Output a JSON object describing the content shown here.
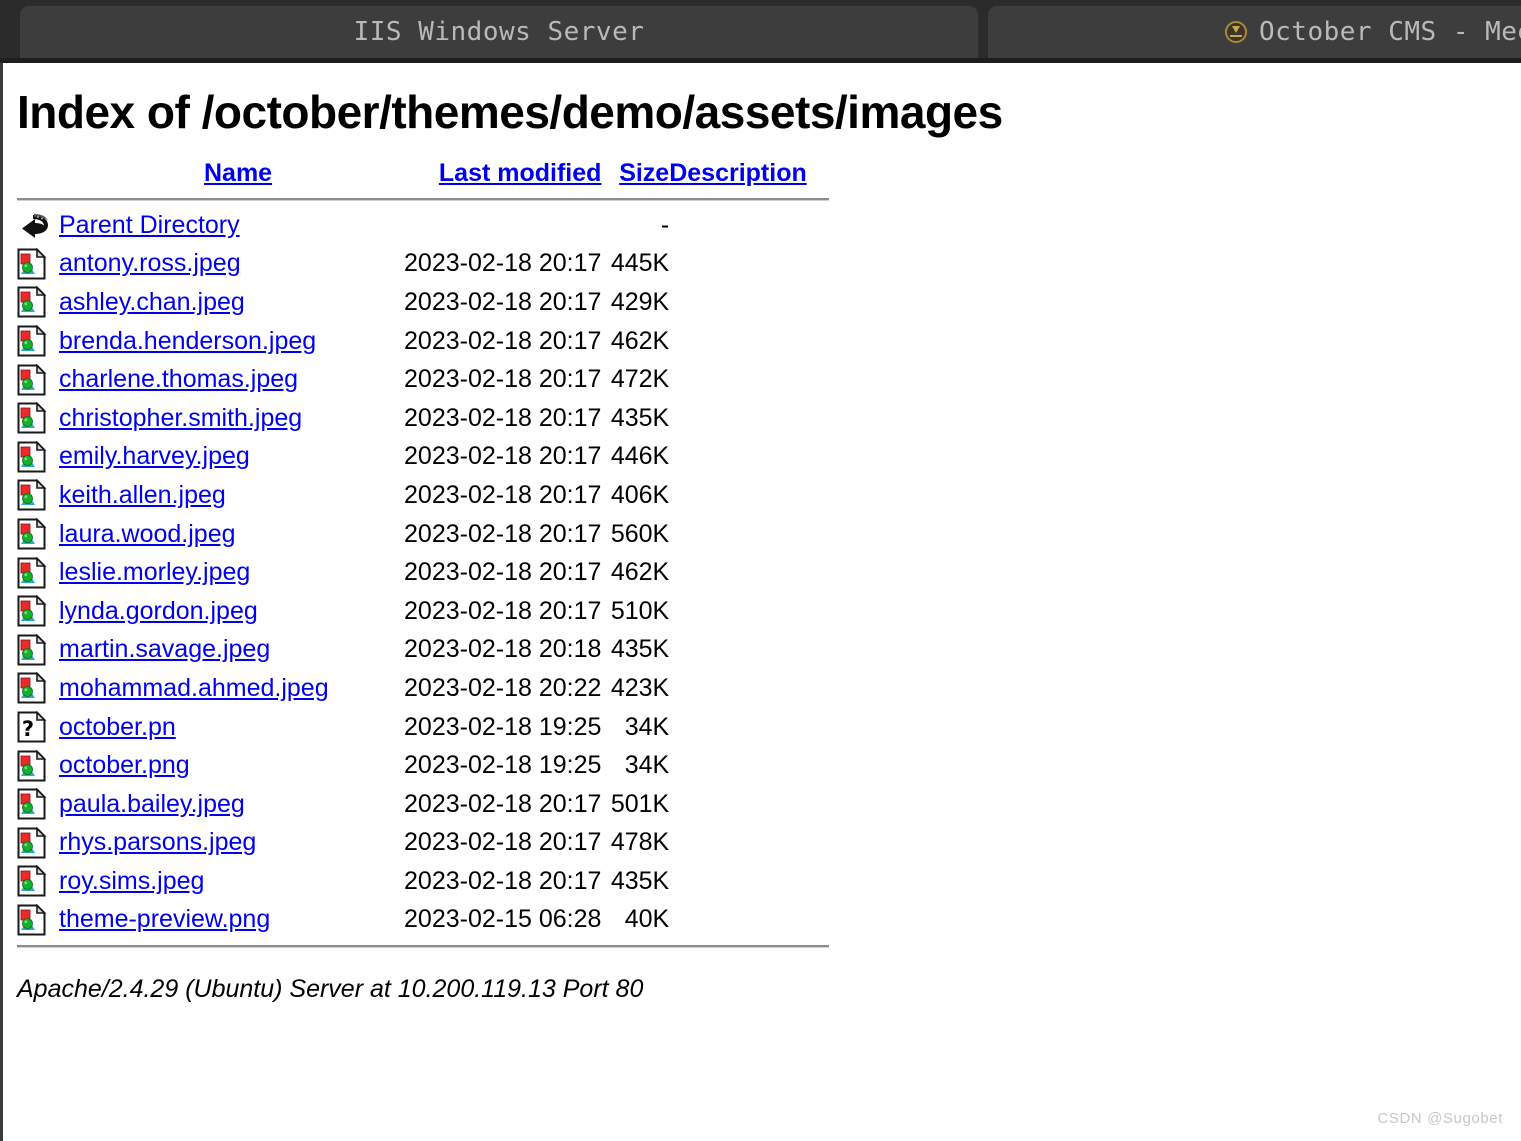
{
  "browser": {
    "tabs": [
      {
        "title": "IIS Windows Server",
        "favicon": null,
        "active": false
      },
      {
        "title": "October CMS - Mee",
        "favicon": "october-cms-favicon",
        "active": true
      }
    ]
  },
  "page": {
    "title": "Index of /october/themes/demo/assets/images",
    "columns": {
      "name": "Name",
      "last_modified": "Last modified",
      "size": "Size",
      "description": "Description"
    },
    "rows": [
      {
        "icon": "back-icon",
        "name": "Parent Directory",
        "last_modified": "",
        "size": "-",
        "description": ""
      },
      {
        "icon": "image-icon",
        "name": "antony.ross.jpeg",
        "last_modified": "2023-02-18 20:17",
        "size": "445K",
        "description": ""
      },
      {
        "icon": "image-icon",
        "name": "ashley.chan.jpeg",
        "last_modified": "2023-02-18 20:17",
        "size": "429K",
        "description": ""
      },
      {
        "icon": "image-icon",
        "name": "brenda.henderson.jpeg",
        "last_modified": "2023-02-18 20:17",
        "size": "462K",
        "description": ""
      },
      {
        "icon": "image-icon",
        "name": "charlene.thomas.jpeg",
        "last_modified": "2023-02-18 20:17",
        "size": "472K",
        "description": ""
      },
      {
        "icon": "image-icon",
        "name": "christopher.smith.jpeg",
        "last_modified": "2023-02-18 20:17",
        "size": "435K",
        "description": ""
      },
      {
        "icon": "image-icon",
        "name": "emily.harvey.jpeg",
        "last_modified": "2023-02-18 20:17",
        "size": "446K",
        "description": ""
      },
      {
        "icon": "image-icon",
        "name": "keith.allen.jpeg",
        "last_modified": "2023-02-18 20:17",
        "size": "406K",
        "description": ""
      },
      {
        "icon": "image-icon",
        "name": "laura.wood.jpeg",
        "last_modified": "2023-02-18 20:17",
        "size": "560K",
        "description": ""
      },
      {
        "icon": "image-icon",
        "name": "leslie.morley.jpeg",
        "last_modified": "2023-02-18 20:17",
        "size": "462K",
        "description": ""
      },
      {
        "icon": "image-icon",
        "name": "lynda.gordon.jpeg",
        "last_modified": "2023-02-18 20:17",
        "size": "510K",
        "description": ""
      },
      {
        "icon": "image-icon",
        "name": "martin.savage.jpeg",
        "last_modified": "2023-02-18 20:18",
        "size": "435K",
        "description": ""
      },
      {
        "icon": "image-icon",
        "name": "mohammad.ahmed.jpeg",
        "last_modified": "2023-02-18 20:22",
        "size": "423K",
        "description": ""
      },
      {
        "icon": "unknown-icon",
        "name": "october.pn",
        "last_modified": "2023-02-18 19:25",
        "size": "34K",
        "description": ""
      },
      {
        "icon": "image-icon",
        "name": "october.png",
        "last_modified": "2023-02-18 19:25",
        "size": "34K",
        "description": ""
      },
      {
        "icon": "image-icon",
        "name": "paula.bailey.jpeg",
        "last_modified": "2023-02-18 20:17",
        "size": "501K",
        "description": ""
      },
      {
        "icon": "image-icon",
        "name": "rhys.parsons.jpeg",
        "last_modified": "2023-02-18 20:17",
        "size": "478K",
        "description": ""
      },
      {
        "icon": "image-icon",
        "name": "roy.sims.jpeg",
        "last_modified": "2023-02-18 20:17",
        "size": "435K",
        "description": ""
      },
      {
        "icon": "image-icon",
        "name": "theme-preview.png",
        "last_modified": "2023-02-15 06:28",
        "size": "40K",
        "description": ""
      }
    ],
    "footer": "Apache/2.4.29 (Ubuntu) Server at 10.200.119.13 Port 80"
  },
  "watermark": "CSDN @Sugobet",
  "colors": {
    "link": "#0000ee",
    "tabstrip_bg": "#2b2b2b",
    "tab_bg": "#3d3d3d",
    "tab_text": "#b9b9b9",
    "page_bg": "#ffffff",
    "rule": "#8c8c8c",
    "watermark": "#c8c8c8"
  }
}
